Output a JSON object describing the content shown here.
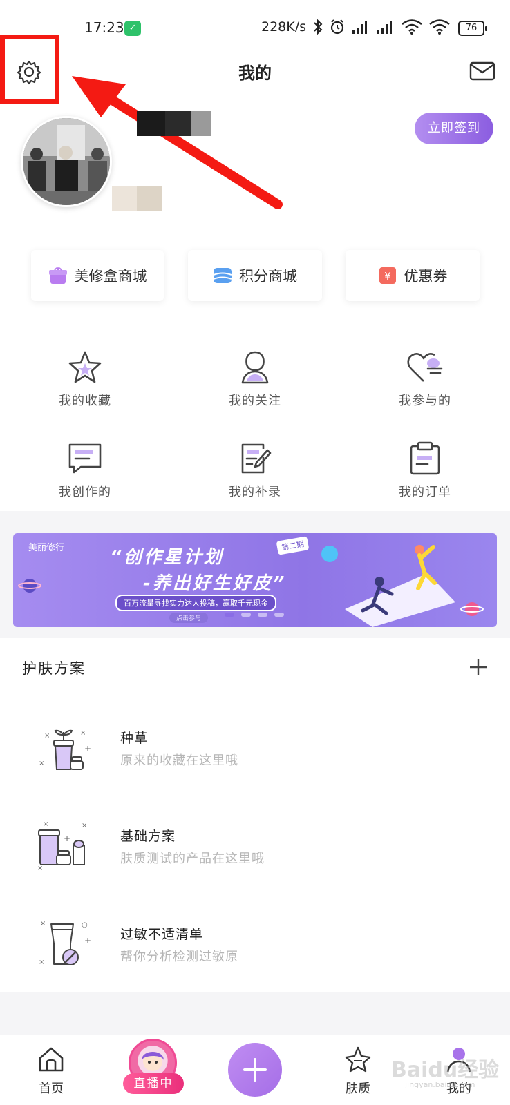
{
  "status": {
    "time": "17:23",
    "net_speed": "228K/s",
    "battery": "76"
  },
  "header": {
    "title": "我的"
  },
  "profile": {
    "signin_label": "立即签到"
  },
  "shops": [
    {
      "label": "美修盒商城",
      "color": "#b97cf0"
    },
    {
      "label": "积分商城",
      "color": "#5aa0f0"
    },
    {
      "label": "优惠券",
      "color": "#f46a5e"
    }
  ],
  "menu": [
    {
      "label": "我的收藏",
      "icon": "star-icon"
    },
    {
      "label": "我的关注",
      "icon": "person-icon"
    },
    {
      "label": "我参与的",
      "icon": "heart-icon"
    },
    {
      "label": "我创作的",
      "icon": "chat-icon"
    },
    {
      "label": "我的补录",
      "icon": "edit-icon"
    },
    {
      "label": "我的订单",
      "icon": "clipboard-icon"
    }
  ],
  "banner": {
    "brand": "美丽修行",
    "title": "“创作星计划",
    "subtitle": "-养出好生好皮”",
    "badge": "第二期",
    "tagline": "百万流量寻找实力达人投稿，赢取千元现金",
    "cta": "点击参与"
  },
  "skincare": {
    "title": "护肤方案",
    "items": [
      {
        "title": "种草",
        "desc": "原来的收藏在这里哦"
      },
      {
        "title": "基础方案",
        "desc": "肤质测试的产品在这里哦"
      },
      {
        "title": "过敏不适清单",
        "desc": "帮你分析检测过敏原"
      }
    ]
  },
  "tabs": {
    "home": "首页",
    "live": "直播中",
    "skin": "肤质",
    "mine": "我的"
  },
  "watermark": {
    "text": "Baidu经验",
    "sub": "jingyan.baidu.com"
  },
  "colors": {
    "accent": "#9b6ee8",
    "annotation_red": "#f41a13"
  }
}
